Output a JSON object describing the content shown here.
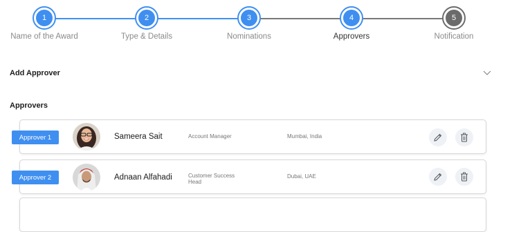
{
  "stepper": {
    "steps": [
      {
        "number": "1",
        "label": "Name of the Award"
      },
      {
        "number": "2",
        "label": "Type & Details"
      },
      {
        "number": "3",
        "label": "Nominations"
      },
      {
        "number": "4",
        "label": "Approvers"
      },
      {
        "number": "5",
        "label": "Notification"
      }
    ],
    "active_step": "Approvers",
    "colors": {
      "complete": "#3f8ff0",
      "pending": "#6b6b6b"
    }
  },
  "add_approver": {
    "title": "Add Approver",
    "toggle_icon": "chevron-down-icon"
  },
  "approvers": {
    "title": "Approvers",
    "items": [
      {
        "badge": "Approver 1",
        "name": "Sameera Sait",
        "role": "Account Manager",
        "location": "Mumbai, India"
      },
      {
        "badge": "Approver 2",
        "name": "Adnaan Alfahadi",
        "role": "Customer Success Head",
        "location": "Dubai, UAE"
      }
    ],
    "actions": {
      "edit_icon": "pencil-icon",
      "delete_icon": "trash-icon"
    }
  }
}
